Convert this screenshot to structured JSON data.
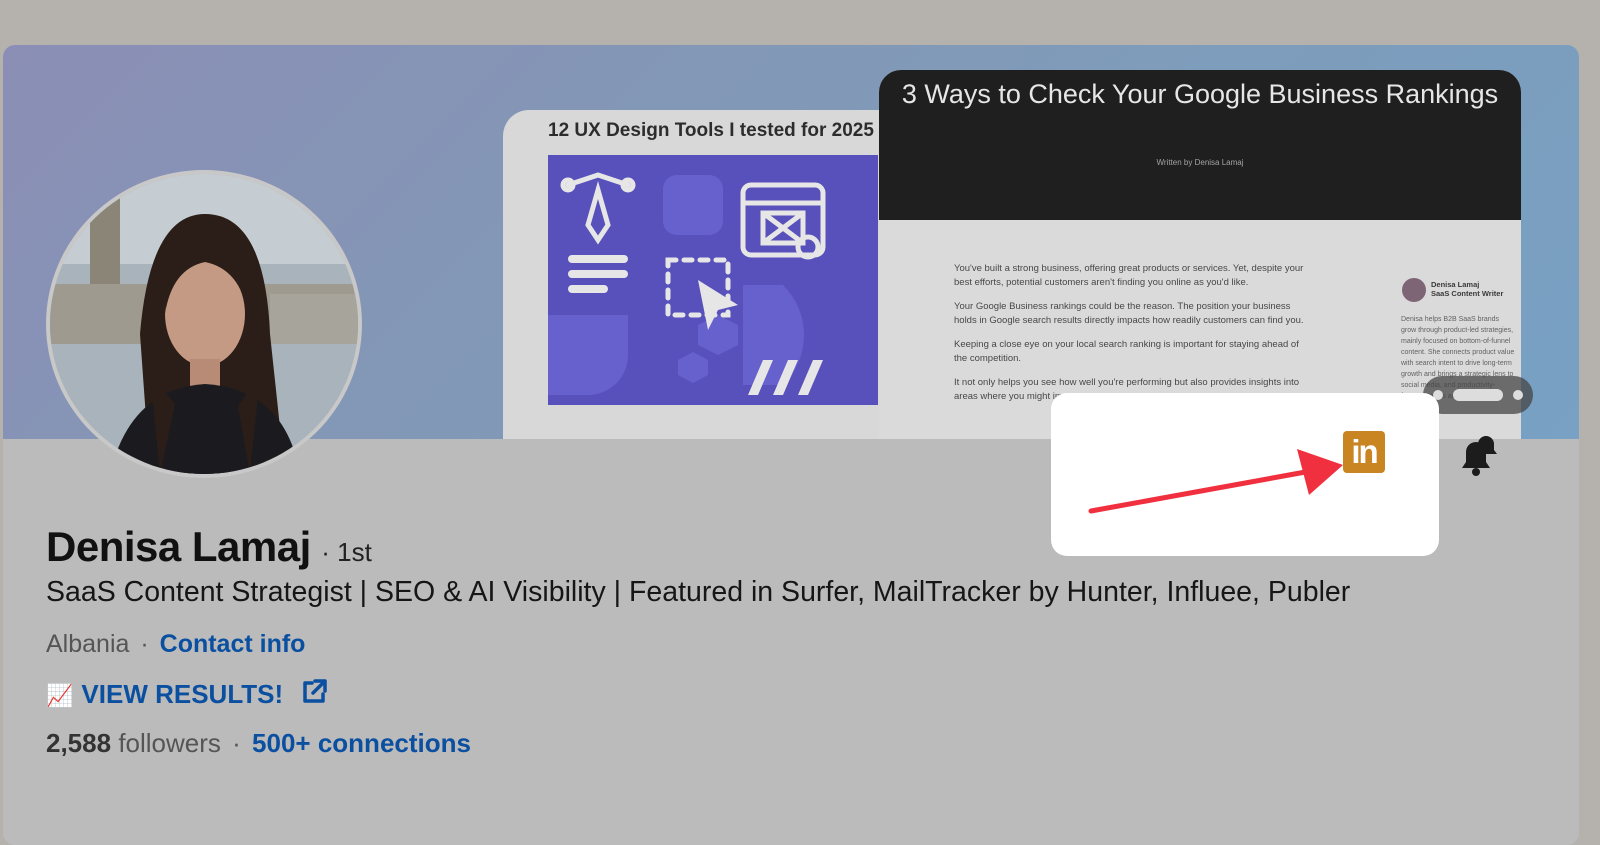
{
  "banner": {
    "slide1_title": "12 UX Design Tools I tested for 2025",
    "slide2_title": "3 Ways to Check Your Google Business Rankings",
    "slide2_byline": "Written by  Denisa Lamaj",
    "slide2_paragraphs": [
      "You've built a strong business, offering great products or services. Yet, despite your best efforts, potential customers aren't finding you online as you'd like.",
      "Your Google Business rankings could be the reason. The position your business holds in Google search results directly impacts how readily customers can find you.",
      "Keeping a close eye on your local search ranking is important for staying ahead of the competition.",
      "It not only helps you see how well you're performing but also provides insights into areas where you might improve."
    ],
    "author_name": "Denisa Lamaj",
    "author_role": "SaaS Content Writer",
    "author_bio": "Denisa helps B2B SaaS brands grow through product-led strategies, mainly focused on bottom-of-funnel content. She connects product value with search intent to drive long-term growth and brings a strategic lens to social media, and productivity-focused topics across the"
  },
  "profile": {
    "name": "Denisa Lamaj",
    "degree": "· 1st",
    "headline": "SaaS Content Strategist | SEO & AI Visibility | Featured in Surfer, MailTracker by Hunter, Influee, Publer",
    "location": "Albania",
    "separator": "·",
    "contact_label": "Contact info",
    "results_emoji": "📈",
    "results_label": "VIEW RESULTS!",
    "followers_count": "2,588",
    "followers_label": "followers",
    "connections_label": "500+ connections"
  },
  "highlight": {
    "logo_text": "in",
    "arrow_color": "#f0303f",
    "logo_color": "#c98521"
  },
  "icons": [
    "linkedin-icon",
    "bell-icon",
    "external-link-icon",
    "chart-emoji-icon",
    "arrow-annotation"
  ]
}
